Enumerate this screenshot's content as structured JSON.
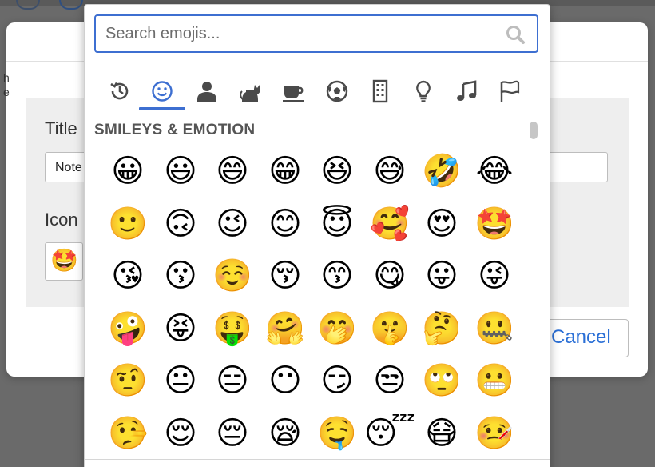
{
  "modal": {
    "title_label": "Title",
    "title_value": "Note",
    "icon_label": "Icon",
    "icon_value": "🤩",
    "cancel_label": "Cancel",
    "left_text": "h\ne"
  },
  "picker": {
    "search": {
      "placeholder": "Search emojis...",
      "value": ""
    },
    "active_tab": "smileys-emotion",
    "tabs": [
      {
        "name": "recent",
        "icon": "clock-history-icon"
      },
      {
        "name": "smileys-emotion",
        "icon": "smiley-icon"
      },
      {
        "name": "people-body",
        "icon": "person-icon"
      },
      {
        "name": "animals-nature",
        "icon": "cat-icon"
      },
      {
        "name": "food-drink",
        "icon": "coffee-cup-icon"
      },
      {
        "name": "activities",
        "icon": "soccer-ball-icon"
      },
      {
        "name": "travel-places",
        "icon": "building-icon"
      },
      {
        "name": "objects",
        "icon": "lightbulb-icon"
      },
      {
        "name": "symbols",
        "icon": "music-note-icon"
      },
      {
        "name": "flags",
        "icon": "flag-icon"
      }
    ],
    "category_title": "SMILEYS & EMOTION",
    "accent_color": "#3d6fd1",
    "emojis": [
      [
        "😀",
        "😃",
        "😄",
        "😁",
        "😆",
        "😅",
        "🤣",
        "😂"
      ],
      [
        "🙂",
        "🙃",
        "😉",
        "😊",
        "😇",
        "🥰",
        "😍",
        "🤩"
      ],
      [
        "😘",
        "😗",
        "☺️",
        "😚",
        "😙",
        "😋",
        "😛",
        "😜"
      ],
      [
        "🤪",
        "😝",
        "🤑",
        "🤗",
        "🤭",
        "🤫",
        "🤔",
        "🤐"
      ],
      [
        "🤨",
        "😐",
        "😑",
        "😶",
        "😏",
        "😒",
        "🙄",
        "😬"
      ],
      [
        "🤥",
        "😌",
        "😔",
        "😪",
        "🤤",
        "😴",
        "😷",
        "🤒"
      ]
    ]
  }
}
